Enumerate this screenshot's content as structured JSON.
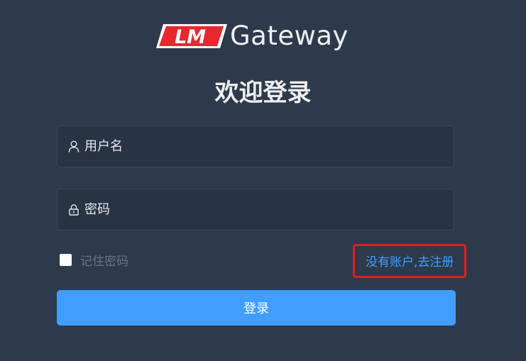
{
  "logo": {
    "badge_text": "LM",
    "name": "Gateway"
  },
  "title": "欢迎登录",
  "username": {
    "placeholder": "用户名",
    "icon": "user-icon"
  },
  "password": {
    "placeholder": "密码",
    "icon": "lock-icon"
  },
  "remember": {
    "label": "记住密码",
    "checked": false
  },
  "register_link": "没有账户,去注册",
  "login_button": "登录",
  "colors": {
    "background": "#2d3a4b",
    "primary": "#409eff",
    "logo_red": "#e8272f",
    "highlight_border": "#e02020"
  }
}
